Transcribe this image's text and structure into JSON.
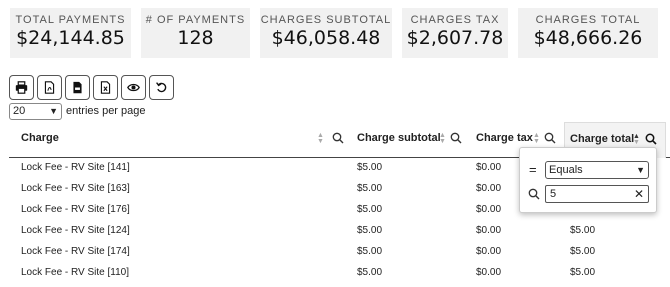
{
  "summary": {
    "total_payments": {
      "label": "TOTAL PAYMENTS",
      "value": "$24,144.85"
    },
    "num_payments": {
      "label": "# OF PAYMENTS",
      "value": "128"
    },
    "charges_subtotal": {
      "label": "CHARGES SUBTOTAL",
      "value": "$46,058.48"
    },
    "charges_tax": {
      "label": "CHARGES TAX",
      "value": "$2,607.78"
    },
    "charges_total": {
      "label": "CHARGES TOTAL",
      "value": "$48,666.26"
    }
  },
  "toolbar": {
    "buttons": [
      {
        "name": "print-icon"
      },
      {
        "name": "pdf-icon"
      },
      {
        "name": "csv-icon"
      },
      {
        "name": "excel-icon"
      },
      {
        "name": "eye-icon"
      },
      {
        "name": "reset-icon"
      }
    ]
  },
  "entries": {
    "selected": "20",
    "label": "entries per page"
  },
  "table": {
    "headers": {
      "charge": "Charge",
      "subtotal": "Charge subtotal",
      "tax": "Charge tax",
      "total": "Charge total"
    },
    "rows": [
      {
        "charge": "Lock Fee - RV Site [141]",
        "subtotal": "$5.00",
        "tax": "$0.00",
        "total": ""
      },
      {
        "charge": "Lock Fee - RV Site [163]",
        "subtotal": "$5.00",
        "tax": "$0.00",
        "total": ""
      },
      {
        "charge": "Lock Fee - RV Site [176]",
        "subtotal": "$5.00",
        "tax": "$0.00",
        "total": ""
      },
      {
        "charge": "Lock Fee - RV Site [124]",
        "subtotal": "$5.00",
        "tax": "$0.00",
        "total": "$5.00"
      },
      {
        "charge": "Lock Fee - RV Site [174]",
        "subtotal": "$5.00",
        "tax": "$0.00",
        "total": "$5.00"
      },
      {
        "charge": "Lock Fee - RV Site [110]",
        "subtotal": "$5.00",
        "tax": "$0.00",
        "total": "$5.00"
      }
    ]
  },
  "filter_popup": {
    "operator_symbol": "=",
    "operator": "Equals",
    "value": "5",
    "clear": "✕"
  }
}
